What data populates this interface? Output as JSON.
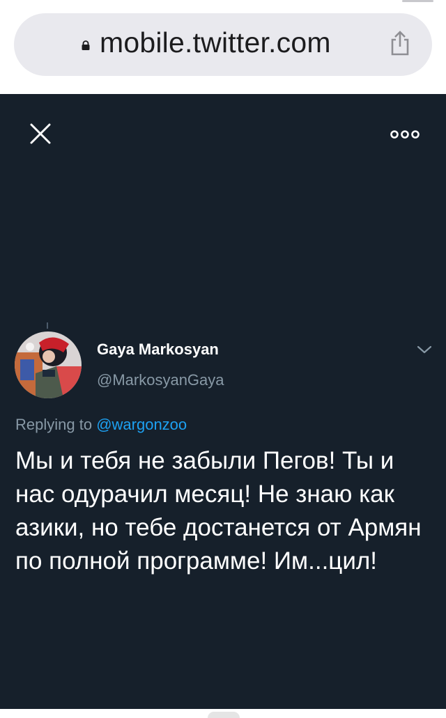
{
  "browser": {
    "url": "mobile.twitter.com",
    "lock_icon": "lock-icon",
    "share_icon": "share-icon"
  },
  "viewer": {
    "close_icon": "close-icon",
    "more_icon": "more-options-icon"
  },
  "tweet": {
    "display_name": "Gaya Markosyan",
    "handle": "@MarkosyanGaya",
    "replying_prefix": "Replying to ",
    "replying_to": "@wargonzoo",
    "text": "Мы и тебя не забыли Пегов! Ты и нас одурачил месяц! Не знаю как азики, но тебе достанется от Армян по полной программе! Им...цил!"
  },
  "colors": {
    "background": "#16202b",
    "text": "#ffffff",
    "secondary_text": "#8899a6",
    "link": "#1da1f2"
  }
}
